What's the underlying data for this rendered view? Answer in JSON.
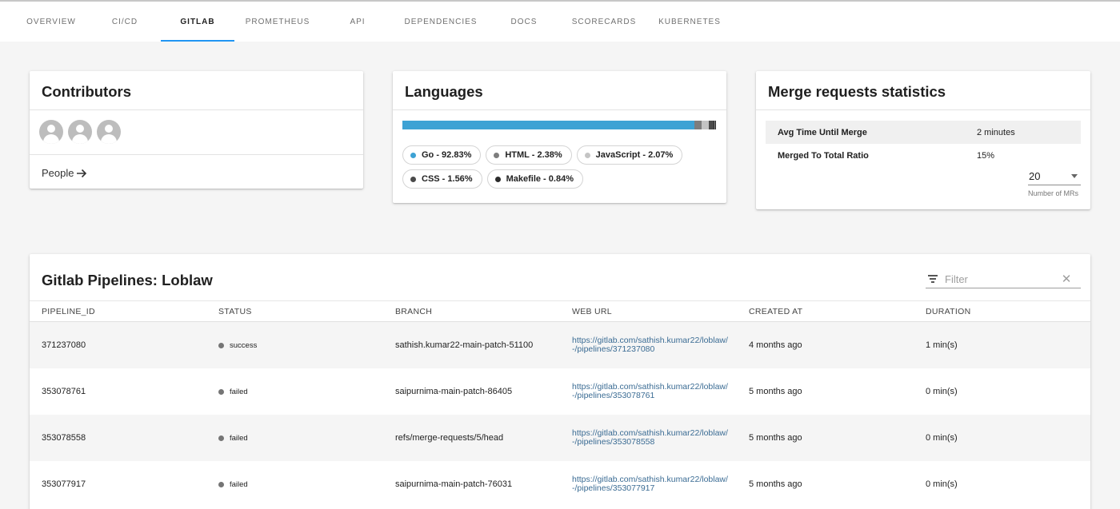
{
  "tabs": [
    {
      "label": "OVERVIEW",
      "active": false
    },
    {
      "label": "CI/CD",
      "active": false
    },
    {
      "label": "GITLAB",
      "active": true
    },
    {
      "label": "PROMETHEUS",
      "active": false
    },
    {
      "label": "API",
      "active": false
    },
    {
      "label": "DEPENDENCIES",
      "active": false
    },
    {
      "label": "DOCS",
      "active": false
    },
    {
      "label": "SCORECARDS",
      "active": false
    },
    {
      "label": "KUBERNETES",
      "active": false
    }
  ],
  "contributors": {
    "title": "Contributors",
    "avatar_icon": "person-avatar-icon",
    "people_link": "People"
  },
  "languages": {
    "title": "Languages",
    "items": [
      {
        "name": "Go",
        "label": "Go - 92.83%",
        "percent": 92.83,
        "color": "#3da2d4"
      },
      {
        "name": "HTML",
        "label": "HTML - 2.38%",
        "percent": 2.38,
        "color": "#7d7d7d"
      },
      {
        "name": "JavaScript",
        "label": "JavaScript - 2.07%",
        "percent": 2.07,
        "color": "#c4c4c4"
      },
      {
        "name": "CSS",
        "label": "CSS - 1.56%",
        "percent": 1.56,
        "color": "#4a4a4a"
      },
      {
        "name": "Makefile",
        "label": "Makefile - 0.84%",
        "percent": 0.84,
        "color": "#2b2b2b"
      }
    ]
  },
  "merge_requests": {
    "title": "Merge requests statistics",
    "rows": [
      {
        "label": "Avg Time Until Merge",
        "value": "2 minutes"
      },
      {
        "label": "Merged To Total Ratio",
        "value": "15%"
      }
    ],
    "select_value": "20",
    "select_helper": "Number of MRs"
  },
  "pipelines": {
    "title": "Gitlab Pipelines: Loblaw",
    "filter_placeholder": "Filter",
    "columns": [
      "PIPELINE_ID",
      "STATUS",
      "BRANCH",
      "WEB URL",
      "CREATED AT",
      "DURATION"
    ],
    "rows": [
      {
        "id": "371237080",
        "status": "success",
        "branch": "sathish.kumar22-main-patch-51100",
        "url": "https://gitlab.com/sathish.kumar22/loblaw/-/pipelines/371237080",
        "created": "4 months ago",
        "duration": "1 min(s)"
      },
      {
        "id": "353078761",
        "status": "failed",
        "branch": "saipurnima-main-patch-86405",
        "url": "https://gitlab.com/sathish.kumar22/loblaw/-/pipelines/353078761",
        "created": "5 months ago",
        "duration": "0 min(s)"
      },
      {
        "id": "353078558",
        "status": "failed",
        "branch": "refs/merge-requests/5/head",
        "url": "https://gitlab.com/sathish.kumar22/loblaw/-/pipelines/353078558",
        "created": "5 months ago",
        "duration": "0 min(s)"
      },
      {
        "id": "353077917",
        "status": "failed",
        "branch": "saipurnima-main-patch-76031",
        "url": "https://gitlab.com/sathish.kumar22/loblaw/-/pipelines/353077917",
        "created": "5 months ago",
        "duration": "0 min(s)"
      }
    ]
  }
}
